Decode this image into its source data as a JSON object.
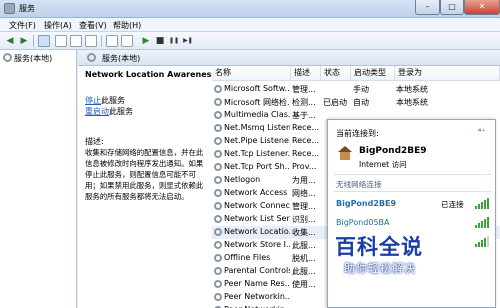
{
  "window": {
    "title": "服务",
    "controls": {
      "minimize": "–",
      "maximize": "□",
      "close": "✕"
    }
  },
  "menu": [
    "文件(F)",
    "操作(A)",
    "查看(V)",
    "帮助(H)"
  ],
  "toolbar_icons": [
    "back-arrow-icon",
    "forward-arrow-icon",
    "console-icon",
    "properties-icon",
    "refresh-icon",
    "export-icon",
    "help-icon",
    "view-icon",
    "play-icon",
    "stop-icon",
    "pause-icon",
    "restart-icon"
  ],
  "toolbar_glyphs": {
    "back": "◀",
    "forward": "▶",
    "play": "▶",
    "stop": "■",
    "pause": "❚❚",
    "restart": "▶❚"
  },
  "tree": {
    "root": "服务(本地)"
  },
  "tab": {
    "label": "服务(本地)"
  },
  "detail": {
    "service_name": "Network Location Awareness",
    "actions": [
      {
        "link": "停止",
        "suffix": "此服务"
      },
      {
        "link": "重启动",
        "suffix": "此服务"
      }
    ],
    "description_label": "描述:",
    "description": "收集和存储网络的配置信息，并在此信息被修改时向程序发出通知。如果停止此服务，则配置信息可能不可用；如果禁用此服务，则显式依赖此服务的所有服务都将无法启动。"
  },
  "columns": [
    "名称",
    "描述",
    "状态",
    "启动类型",
    "登录为"
  ],
  "services": [
    {
      "name": "Microsoft Softw...",
      "desc": "管理...",
      "status": "",
      "startup": "手动",
      "logon": "本地系统"
    },
    {
      "name": "Microsoft 网络检...",
      "desc": "检测...",
      "status": "已启动",
      "startup": "自动",
      "logon": "本地系统"
    },
    {
      "name": "Multimedia Clas...",
      "desc": "基于...",
      "status": "",
      "startup": "",
      "logon": ""
    },
    {
      "name": "Net.Msmq Listen...",
      "desc": "Rece...",
      "status": "",
      "startup": "",
      "logon": ""
    },
    {
      "name": "Net.Pipe Listene...",
      "desc": "Rece...",
      "status": "",
      "startup": "",
      "logon": ""
    },
    {
      "name": "Net.Tcp Listener...",
      "desc": "Rece...",
      "status": "",
      "startup": "",
      "logon": ""
    },
    {
      "name": "Net.Tcp Port Sh...",
      "desc": "Prov...",
      "status": "",
      "startup": "",
      "logon": ""
    },
    {
      "name": "Netlogon",
      "desc": "为用...",
      "status": "",
      "startup": "",
      "logon": ""
    },
    {
      "name": "Network Access ...",
      "desc": "网络...",
      "status": "",
      "startup": "",
      "logon": ""
    },
    {
      "name": "Network Connec...",
      "desc": "管理...",
      "status": "",
      "startup": "",
      "logon": ""
    },
    {
      "name": "Network List Ser...",
      "desc": "识别...",
      "status": "",
      "startup": "",
      "logon": ""
    },
    {
      "name": "Network Locatio...",
      "desc": "收集...",
      "status": "",
      "startup": "",
      "logon": ""
    },
    {
      "name": "Network Store I...",
      "desc": "此服...",
      "status": "",
      "startup": "",
      "logon": ""
    },
    {
      "name": "Offline Files",
      "desc": "脱机...",
      "status": "",
      "startup": "",
      "logon": ""
    },
    {
      "name": "Parental Controls",
      "desc": "此服...",
      "status": "",
      "startup": "",
      "logon": ""
    },
    {
      "name": "Peer Name Res...",
      "desc": "使用...",
      "status": "",
      "startup": "",
      "logon": ""
    },
    {
      "name": "Peer Networkin...",
      "desc": "",
      "status": "",
      "startup": "",
      "logon": ""
    },
    {
      "name": "Peer Networkin...",
      "desc": "",
      "status": "",
      "startup": "",
      "logon": ""
    }
  ],
  "network_popup": {
    "connected_label": "当前连接到:",
    "help": "⁴⁺",
    "current_network": "BigPond2BE9",
    "access": "Internet 访问",
    "section": "无线网络连接",
    "wifi": [
      {
        "name": "BigPond2BE9",
        "status": "已连接",
        "bars": 4
      },
      {
        "name": "BigPond05BA",
        "status": "",
        "bars": 4
      },
      {
        "name": "Tels",
        "status": "",
        "bars": 3
      }
    ]
  },
  "watermark": {
    "main": "百科全说",
    "sub": "助你轻松解决"
  }
}
